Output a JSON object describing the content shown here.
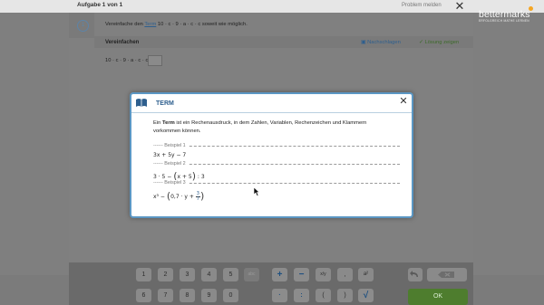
{
  "header": {
    "task_title": "Aufgabe 1 von 1",
    "problem_report": "Problem melden",
    "close_symbol": "✕",
    "brand": "bettermarks",
    "brand_tagline": "ERFOLGREICH MATHE LERNEN"
  },
  "task": {
    "step_number": "1",
    "instruction_before": "Vereinfache den ",
    "instruction_link": "Term",
    "instruction_after": " 10 · c · 9 · a · c · c soweit wie möglich.",
    "section_title": "Vereinfachen",
    "lookup_label": "Nachschlagen",
    "solution_label": "Lösung zeigen",
    "expression": "10 · c · 9 · a · c · c ="
  },
  "keyboard": {
    "row1": [
      "1",
      "2",
      "3",
      "4",
      "5",
      "abc",
      "+",
      "−",
      "x/y",
      ",",
      "a²"
    ],
    "row2": [
      "6",
      "7",
      "8",
      "9",
      "0",
      "",
      "·",
      ":",
      "(",
      ")",
      "√"
    ],
    "ok_label": "OK"
  },
  "modal": {
    "title": "TERM",
    "close_symbol": "✕",
    "def_pre": "Ein ",
    "def_bold": "Term",
    "def_post": " ist ein Rechenausdruck, in dem Zahlen, Variablen, Rechenzeichen und Klammern vorkommen können.",
    "examples": [
      {
        "label": "Beispiel 1",
        "formula": "3x + 5y − 7"
      },
      {
        "label": "Beispiel 2",
        "formula_a": "3 · 5 − ",
        "formula_inner": "x + 5",
        "formula_b": " : 3"
      },
      {
        "label": "Beispiel 3",
        "formula_a": "x³ − ",
        "formula_inner": "0,7 · y + ",
        "frac_num": "3",
        "frac_den": "7"
      }
    ]
  },
  "colors": {
    "accent": "#5b97c4",
    "link": "#2e5f8e",
    "ok": "#4e7d2e"
  }
}
